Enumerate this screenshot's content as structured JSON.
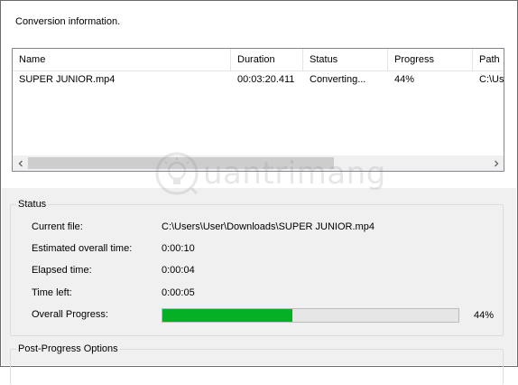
{
  "header": {
    "title": "Conversion information."
  },
  "list": {
    "columns": [
      "Name",
      "Duration",
      "Status",
      "Progress",
      "Path"
    ],
    "rows": [
      {
        "name": "SUPER JUNIOR.mp4",
        "duration": "00:03:20.411",
        "status": "Converting...",
        "progress": "44%",
        "path": "C:\\Us"
      }
    ]
  },
  "status": {
    "legend": "Status",
    "labels": {
      "current_file": "Current file:",
      "estimated_time": "Estimated overall time:",
      "elapsed_time": "Elapsed time:",
      "time_left": "Time left:",
      "overall_progress": "Overall Progress:"
    },
    "values": {
      "current_file": "C:\\Users\\User\\Downloads\\SUPER JUNIOR.mp4",
      "estimated_time": "0:00:10",
      "elapsed_time": "0:00:04",
      "time_left": "0:00:05"
    },
    "progress_fraction": 0.44,
    "progress_text": "44%",
    "progress_color": "#06b025"
  },
  "post_progress": {
    "legend": "Post-Progress Options"
  },
  "watermark": {
    "text": "uantrimang"
  },
  "icons": {
    "scroll_left": "chevron-left-icon",
    "scroll_right": "chevron-right-icon",
    "watermark_logo": "lightbulb-icon"
  }
}
